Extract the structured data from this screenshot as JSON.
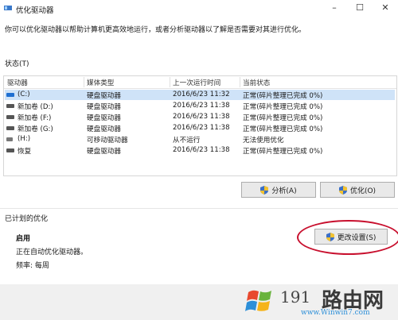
{
  "window": {
    "title": "优化驱动器",
    "app_icon": "defrag-icon"
  },
  "description": "你可以优化驱动器以帮助计算机更高效地运行，或者分析驱动器以了解是否需要对其进行优化。",
  "status_label": "状态(T)",
  "table": {
    "columns": [
      "驱动器",
      "媒体类型",
      "上一次运行时间",
      "当前状态"
    ],
    "rows": [
      {
        "drive": "(C:)",
        "type": "硬盘驱动器",
        "last_run": "2016/6/23 11:32",
        "status": "正常(碎片整理已完成 0%)",
        "icon": "windows-drive-icon",
        "selected": true
      },
      {
        "drive": "新加卷 (D:)",
        "type": "硬盘驱动器",
        "last_run": "2016/6/23 11:38",
        "status": "正常(碎片整理已完成 0%)",
        "icon": "hdd-icon"
      },
      {
        "drive": "新加卷 (F:)",
        "type": "硬盘驱动器",
        "last_run": "2016/6/23 11:38",
        "status": "正常(碎片整理已完成 0%)",
        "icon": "hdd-icon"
      },
      {
        "drive": "新加卷 (G:)",
        "type": "硬盘驱动器",
        "last_run": "2016/6/23 11:38",
        "status": "正常(碎片整理已完成 0%)",
        "icon": "hdd-icon"
      },
      {
        "drive": "(H:)",
        "type": "可移动驱动器",
        "last_run": "从不运行",
        "status": "无法使用优化",
        "icon": "usb-drive-icon"
      },
      {
        "drive": "恢复",
        "type": "硬盘驱动器",
        "last_run": "2016/6/23 11:38",
        "status": "正常(碎片整理已完成 0%)",
        "icon": "hdd-icon"
      }
    ]
  },
  "buttons": {
    "analyze": "分析(A)",
    "optimize": "优化(O)",
    "change_settings": "更改设置(S)"
  },
  "scheduled": {
    "label": "已计划的优化",
    "state": "启用",
    "detail": "正在自动优化驱动器。",
    "frequency": "频率: 每周"
  },
  "watermark": {
    "number": "191",
    "brand": "路由网",
    "url": "www.Winwin7.com"
  },
  "colors": {
    "selection": "#cfe3f8",
    "highlight_ring": "#c8102e"
  }
}
